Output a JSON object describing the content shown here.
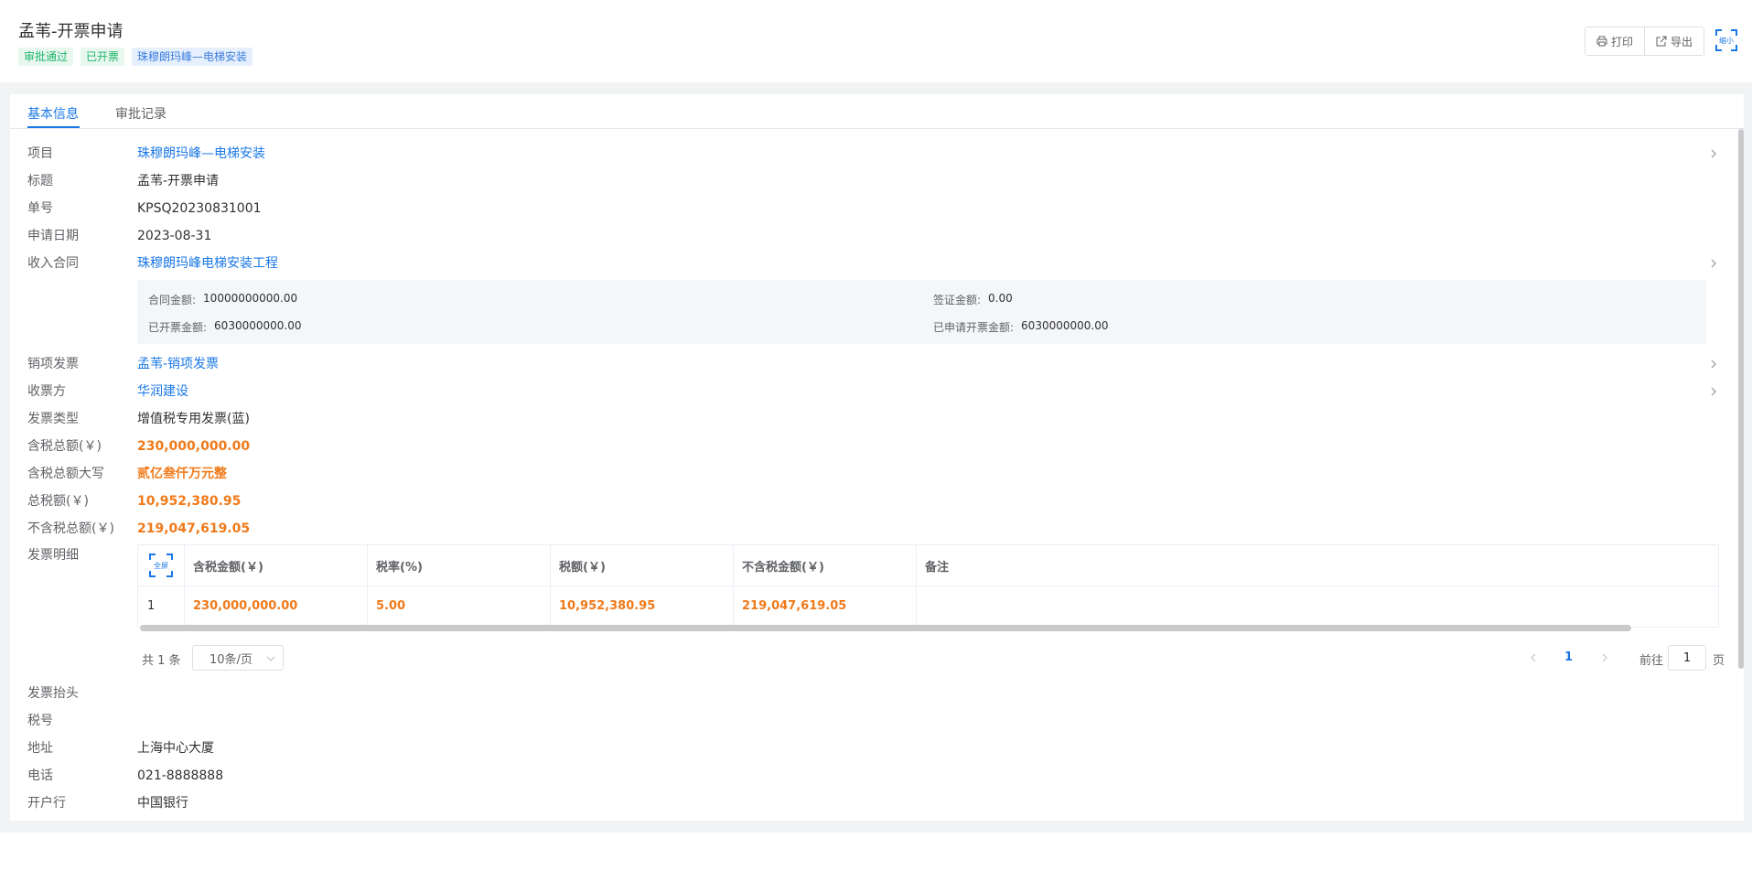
{
  "header": {
    "title": "孟苇-开票申请",
    "tags": [
      "审批通过",
      "已开票",
      "珠穆朗玛峰—电梯安装"
    ],
    "print_label": "打印",
    "export_label": "导出",
    "shrink_label": "缩小"
  },
  "tabs": [
    "基本信息",
    "审批记录"
  ],
  "fields": {
    "project": {
      "label": "项目",
      "value": "珠穆朗玛峰—电梯安装"
    },
    "title": {
      "label": "标题",
      "value": "孟苇-开票申请"
    },
    "number": {
      "label": "单号",
      "value": "KPSQ20230831001"
    },
    "apply_date": {
      "label": "申请日期",
      "value": "2023-08-31"
    },
    "contract": {
      "label": "收入合同",
      "value": "珠穆朗玛峰电梯安装工程"
    },
    "sales_invoice": {
      "label": "销项发票",
      "value": "孟苇-销项发票"
    },
    "payee": {
      "label": "收票方",
      "value": "华润建设"
    },
    "invoice_type": {
      "label": "发票类型",
      "value": "增值税专用发票(蓝)"
    },
    "total_incl_tax": {
      "label": "含税总额(￥)",
      "value": "230,000,000.00"
    },
    "total_uppercase": {
      "label": "含税总额大写",
      "value": "贰亿叁仟万元整"
    },
    "total_tax": {
      "label": "总税额(￥)",
      "value": "10,952,380.95"
    },
    "total_excl_tax": {
      "label": "不含税总额(￥)",
      "value": "219,047,619.05"
    },
    "invoice_detail": {
      "label": "发票明细"
    },
    "invoice_header": {
      "label": "发票抬头",
      "value": ""
    },
    "tax_no": {
      "label": "税号",
      "value": ""
    },
    "address": {
      "label": "地址",
      "value": "上海中心大厦"
    },
    "phone": {
      "label": "电话",
      "value": "021-8888888"
    },
    "bank": {
      "label": "开户行",
      "value": "中国银行"
    }
  },
  "contract_info": {
    "contract_amount": {
      "label": "合同金额:",
      "value": "10000000000.00"
    },
    "visa_amount": {
      "label": "签证金额:",
      "value": "0.00"
    },
    "invoiced_amount": {
      "label": "已开票金额:",
      "value": "6030000000.00"
    },
    "applied_amount": {
      "label": "已申请开票金额:",
      "value": "6030000000.00"
    }
  },
  "detail_table": {
    "fullscreen_label": "全屏",
    "columns": [
      "含税金额(￥)",
      "税率(%)",
      "税额(￥)",
      "不含税金额(￥)",
      "备注"
    ],
    "rows": [
      {
        "index": "1",
        "incl_tax": "230,000,000.00",
        "rate": "5.00",
        "tax": "10,952,380.95",
        "excl_tax": "219,047,619.05",
        "remark": ""
      }
    ]
  },
  "pagination": {
    "total_text": "共 1 条",
    "page_size": "10条/页",
    "current_page": "1",
    "goto_label": "前往",
    "goto_value": "1",
    "page_suffix": "页"
  },
  "colors": {
    "accent": "#1a78e6",
    "amount": "#f07a1a",
    "tag_green": "#1fb56b"
  }
}
